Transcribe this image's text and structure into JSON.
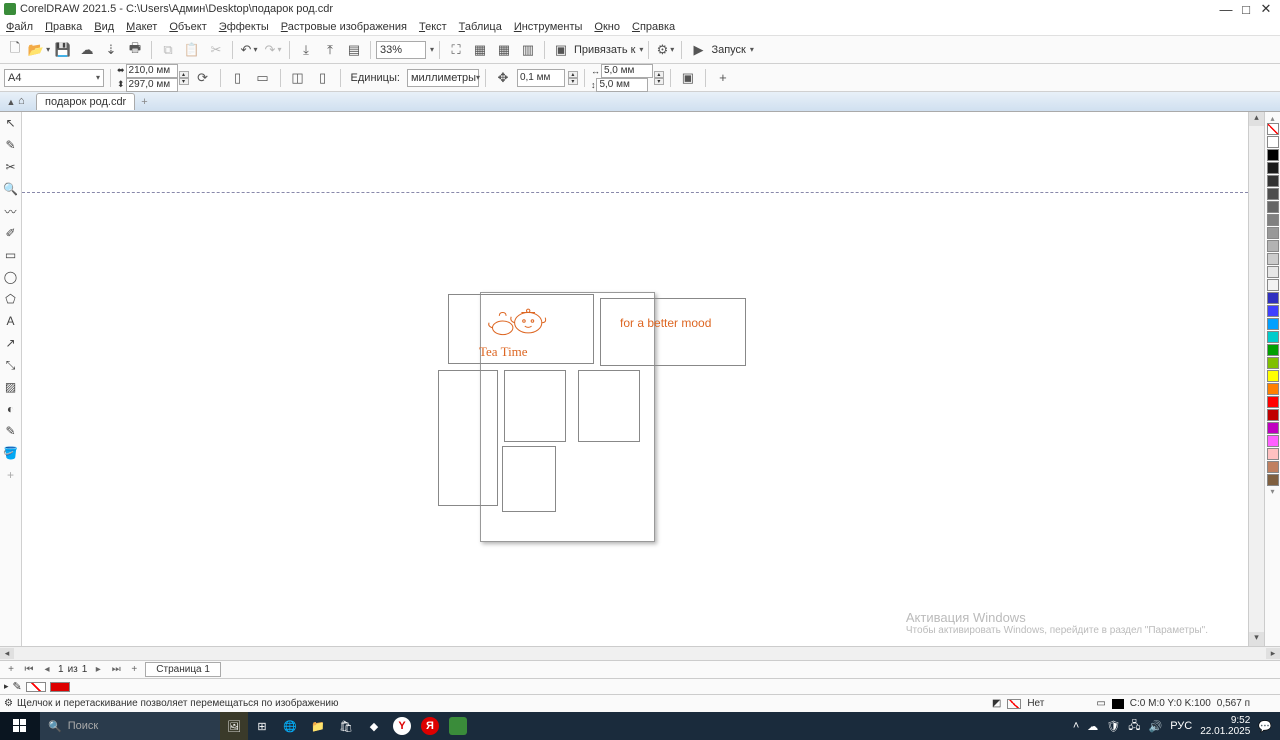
{
  "titlebar": {
    "title": "CorelDRAW 2021.5 - C:\\Users\\Админ\\Desktop\\подарок род.cdr"
  },
  "menu": {
    "file": "Файл",
    "edit": "Правка",
    "view": "Вид",
    "layout": "Макет",
    "object": "Объект",
    "effects": "Эффекты",
    "bitmaps": "Растровые изображения",
    "text": "Текст",
    "table": "Таблица",
    "tools": "Инструменты",
    "window": "Окно",
    "help": "Справка"
  },
  "toolbar": {
    "zoom": "33%",
    "snap_label": "Привязать к",
    "launch": "Запуск"
  },
  "props": {
    "pagesize": "A4",
    "width": "210,0 мм",
    "height": "297,0 мм",
    "units_label": "Единицы:",
    "units_value": "миллиметры",
    "nudge": "0,1 мм",
    "dupx": "5,0 мм",
    "dupy": "5,0 мм"
  },
  "doc_tab": "подарок род.cdr",
  "artwork": {
    "tea": "Tea Time",
    "mood": "for  a better mood"
  },
  "pagebar": {
    "current": "1",
    "of_label": "из",
    "total": "1",
    "page_tab": "Страница 1"
  },
  "status": {
    "hint": "Щелчок и перетаскивание позволяет перемещаться по изображению",
    "fill_label": "Нет",
    "cmyk": "C:0 M:0 Y:0 K:100",
    "outline": "0,567 п"
  },
  "watermark": {
    "title": "Активация Windows",
    "sub": "Чтобы активировать Windows, перейдите в раздел \"Параметры\"."
  },
  "taskbar": {
    "search_placeholder": "Поиск",
    "lang": "РУС",
    "time": "9:52",
    "date": "22.01.2025"
  },
  "colors": [
    "#ffffff",
    "#000000",
    "#1a1a1a",
    "#333333",
    "#4d4d4d",
    "#666666",
    "#808080",
    "#999999",
    "#b3b3b3",
    "#cccccc",
    "#e6e6e6",
    "#f2f2f2",
    "#3030c0",
    "#4040ff",
    "#00a0ff",
    "#00cccc",
    "#00a000",
    "#80c000",
    "#ffff00",
    "#ff8000",
    "#ff0000",
    "#c00000",
    "#c000c0",
    "#ff60ff",
    "#ffc0c0",
    "#c08060",
    "#806040"
  ]
}
